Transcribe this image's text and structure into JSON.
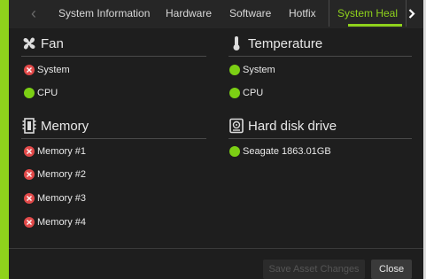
{
  "colors": {
    "accent": "#8fd21c",
    "ok": "#7ccf14",
    "bad": "#e24a4a",
    "background": "#1e1e1e"
  },
  "tabs": [
    {
      "label": "System Information",
      "active": false
    },
    {
      "label": "Hardware",
      "active": false
    },
    {
      "label": "Software",
      "active": false
    },
    {
      "label": "Hotfix",
      "active": false
    },
    {
      "label": "System Heal",
      "active": true
    }
  ],
  "sections": {
    "fan": {
      "title": "Fan",
      "icon": "fan-icon",
      "items": [
        {
          "label": "System",
          "status": "bad"
        },
        {
          "label": "CPU",
          "status": "ok"
        }
      ]
    },
    "temperature": {
      "title": "Temperature",
      "icon": "thermometer-icon",
      "items": [
        {
          "label": "System",
          "status": "ok"
        },
        {
          "label": "CPU",
          "status": "ok"
        }
      ]
    },
    "memory": {
      "title": "Memory",
      "icon": "memory-icon",
      "items": [
        {
          "label": "Memory #1",
          "status": "bad"
        },
        {
          "label": "Memory #2",
          "status": "bad"
        },
        {
          "label": "Memory #3",
          "status": "bad"
        },
        {
          "label": "Memory #4",
          "status": "bad"
        }
      ]
    },
    "disk": {
      "title": "Hard disk drive",
      "icon": "hard-disk-icon",
      "items": [
        {
          "label": "Seagate 1863.01GB",
          "status": "ok"
        }
      ]
    }
  },
  "footer": {
    "save_label": "Save Asset Changes",
    "close_label": "Close"
  }
}
